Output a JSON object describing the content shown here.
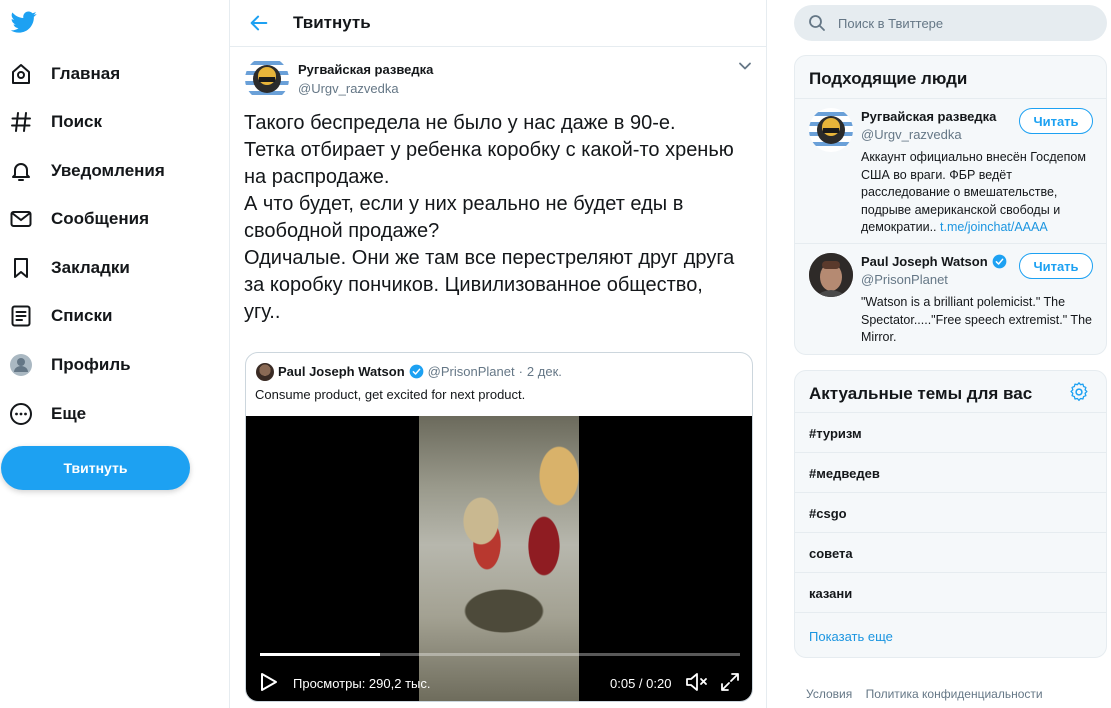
{
  "nav": {
    "logo_icon": "twitter-bird-icon",
    "items": [
      {
        "label": "Главная",
        "icon": "home-icon"
      },
      {
        "label": "Поиск",
        "icon": "hashtag-icon"
      },
      {
        "label": "Уведомления",
        "icon": "bell-icon"
      },
      {
        "label": "Сообщения",
        "icon": "envelope-icon"
      },
      {
        "label": "Закладки",
        "icon": "bookmark-icon"
      },
      {
        "label": "Списки",
        "icon": "list-icon"
      },
      {
        "label": "Профиль",
        "icon": "profile-icon"
      },
      {
        "label": "Еще",
        "icon": "more-icon"
      }
    ],
    "tweet_button": "Твитнуть"
  },
  "main": {
    "header_title": "Твитнуть",
    "tweet": {
      "author_name": "Ругвайская разведка",
      "author_handle": "@Urgv_razvedka",
      "text_lines": [
        "Такого беспредела не было у нас даже в 90-е.",
        "Тетка отбирает у ребенка коробку с какой-то хренью",
        "на распродаже.",
        "А что будет, если у них реально не будет еды в",
        "свободной продаже?",
        "Одичалые. Они же там все перестреляют друг друга",
        "за коробку пончиков. Цивилизованное общество,",
        "угу.."
      ],
      "quote": {
        "name": "Paul Joseph Watson",
        "handle": "@PrisonPlanet",
        "separator": "·",
        "date": "2 дек.",
        "text": "Consume product, get excited for next product.",
        "video": {
          "views": "Просмотры: 290,2 тыс.",
          "time": "0:05 / 0:20",
          "progress": 0.25
        }
      }
    }
  },
  "right": {
    "search_placeholder": "Поиск в Твиттере",
    "who_to_follow": {
      "title": "Подходящие люди",
      "people": [
        {
          "name": "Ругвайская разведка",
          "handle": "@Urgv_razvedka",
          "follow": "Читать",
          "verified": false,
          "bio": "Аккаунт официально внесён Госдепом США во враги. ФБР ведёт расследование о вмешательстве, подрыве американской свободы и демократии.. ",
          "bio_link": "t.me/joinchat/AAAA"
        },
        {
          "name": "Paul Joseph Watson",
          "handle": "@PrisonPlanet",
          "follow": "Читать",
          "verified": true,
          "bio": "\"Watson is a brilliant polemicist.\" The Spectator.....\"Free speech extremist.\" The Mirror.",
          "bio_link": ""
        }
      ]
    },
    "trends": {
      "title": "Актуальные темы для вас",
      "items": [
        "#туризм",
        "#медведев",
        "#csgo",
        "совета",
        "казани"
      ],
      "show_more": "Показать еще"
    },
    "footer": [
      "Условия",
      "Политика конфиденциальности"
    ]
  },
  "colors": {
    "accent": "#1da1f2",
    "link": "#1b95e0",
    "muted": "#657786",
    "border": "#e6ecf0",
    "panel_bg": "#f5f8fa"
  }
}
